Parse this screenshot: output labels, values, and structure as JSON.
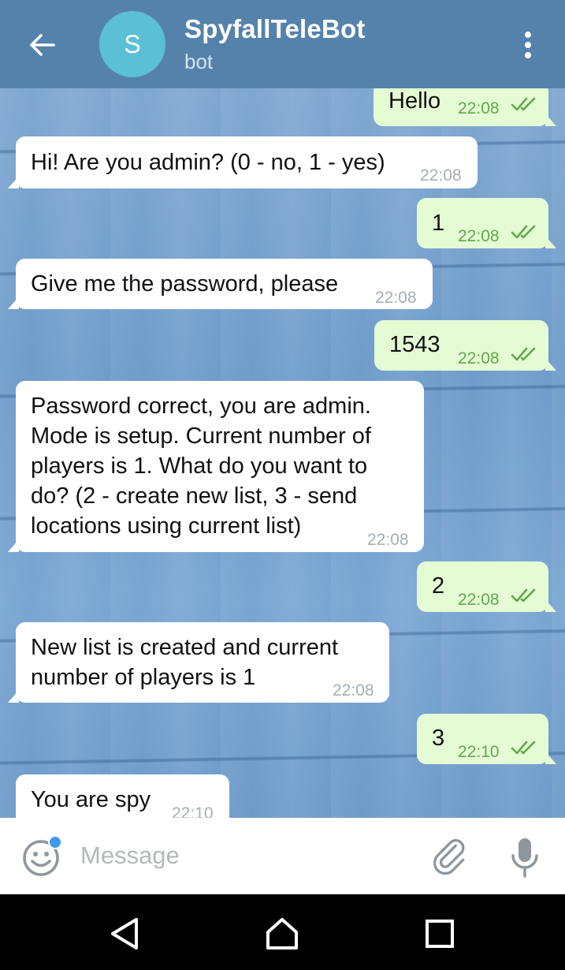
{
  "header": {
    "title": "SpyfallTeleBot",
    "subtitle": "bot",
    "avatar_letter": "S",
    "back_icon": "arrow-left-icon",
    "menu_icon": "more-vertical-icon"
  },
  "messages": [
    {
      "dir": "out",
      "text": "Hello",
      "time": "22:08",
      "status": "read"
    },
    {
      "dir": "in",
      "text": "Hi! Are you admin? (0 - no, 1 - yes)",
      "time": "22:08"
    },
    {
      "dir": "out",
      "text": "1",
      "time": "22:08",
      "status": "read"
    },
    {
      "dir": "in",
      "text": "Give me the password, please",
      "time": "22:08"
    },
    {
      "dir": "out",
      "text": "1543",
      "time": "22:08",
      "status": "read"
    },
    {
      "dir": "in",
      "text": "Password correct, you are admin.\nMode is setup. Current number of\nplayers is 1. What do you want to\ndo? (2 - create new list, 3 - send\nlocations using current list)",
      "time": "22:08"
    },
    {
      "dir": "out",
      "text": "2",
      "time": "22:08",
      "status": "read"
    },
    {
      "dir": "in",
      "text": "New list is created and current\nnumber of players is 1",
      "time": "22:08"
    },
    {
      "dir": "out",
      "text": "3",
      "time": "22:10",
      "status": "read"
    },
    {
      "dir": "in",
      "text": "You are spy",
      "time": "22:10"
    }
  ],
  "input": {
    "placeholder": "Message",
    "emoji_icon": "emoji-icon",
    "attach_icon": "paperclip-icon",
    "mic_icon": "microphone-icon"
  },
  "navbar": {
    "back_icon": "nav-back-icon",
    "home_icon": "nav-home-icon",
    "recents_icon": "nav-recents-icon"
  },
  "colors": {
    "header": "#5482ab",
    "incoming_bubble": "#ffffff",
    "outgoing_bubble": "#e4fbd4",
    "read_check": "#62a84b",
    "avatar": "#5bbfd6"
  }
}
